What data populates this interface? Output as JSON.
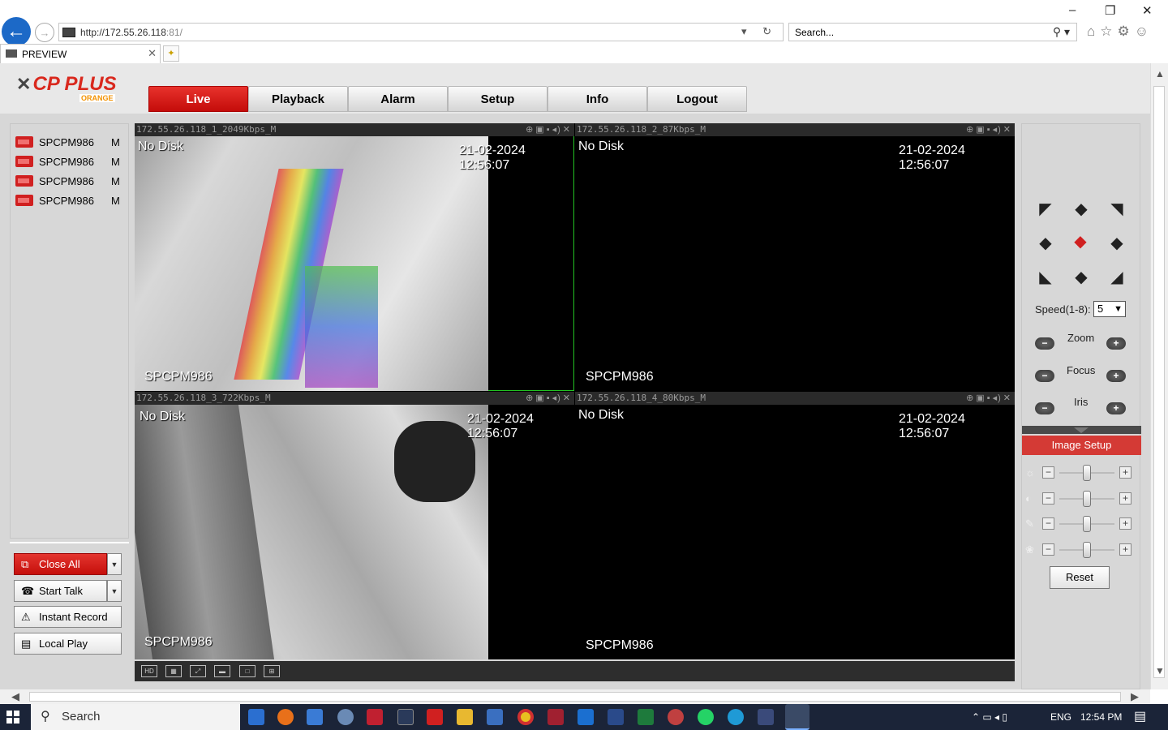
{
  "browser": {
    "url_prefix": "http://",
    "url_host": "172.55.26.118",
    "url_suffix": ":81/",
    "search_placeholder": "Search...",
    "tab_title": "PREVIEW",
    "minimize": "–",
    "restore": "❐",
    "close": "✕"
  },
  "app": {
    "logo_text": "CP PLUS",
    "logo_sub": "ORANGE",
    "nav": [
      {
        "label": "Live",
        "active": true
      },
      {
        "label": "Playback",
        "active": false
      },
      {
        "label": "Alarm",
        "active": false
      },
      {
        "label": "Setup",
        "active": false
      },
      {
        "label": "Info",
        "active": false
      },
      {
        "label": "Logout",
        "active": false
      }
    ],
    "channels": [
      {
        "name": "SPCPM986",
        "stream": "M"
      },
      {
        "name": "SPCPM986",
        "stream": "M"
      },
      {
        "name": "SPCPM986",
        "stream": "M"
      },
      {
        "name": "SPCPM986",
        "stream": "M"
      }
    ],
    "controls": {
      "close_all": "Close All",
      "start_talk": "Start Talk",
      "instant_record": "Instant Record",
      "local_play": "Local Play"
    },
    "video_cells": [
      {
        "title": "172.55.26.118_1_2049Kbps_M",
        "status": "No Disk",
        "timestamp": "21-02-2024 12:56:07",
        "camera": "SPCPM986"
      },
      {
        "title": "172.55.26.118_2_87Kbps_M",
        "status": "No Disk",
        "timestamp": "21-02-2024 12:56:07",
        "camera": "SPCPM986"
      },
      {
        "title": "172.55.26.118_3_722Kbps_M",
        "status": "No Disk",
        "timestamp": "21-02-2024 12:56:07",
        "camera": "SPCPM986"
      },
      {
        "title": "172.55.26.118_4_80Kbps_M",
        "status": "No Disk",
        "timestamp": "21-02-2024 12:56:07",
        "camera": "SPCPM986"
      }
    ],
    "ptz": {
      "speed_label": "Speed(1-8):",
      "speed_value": "5",
      "zoom_label": "Zoom",
      "focus_label": "Focus",
      "iris_label": "Iris",
      "image_setup": "Image Setup",
      "reset": "Reset"
    },
    "image_sliders": [
      {
        "icon": "brightness-icon",
        "value": 0.5
      },
      {
        "icon": "contrast-icon",
        "value": 0.5
      },
      {
        "icon": "saturation-icon",
        "value": 0.5
      },
      {
        "icon": "hue-icon",
        "value": 0.5
      }
    ]
  },
  "taskbar": {
    "search_label": "Search",
    "language": "ENG",
    "time": "12:54 PM"
  },
  "colors": {
    "accent_red": "#d43a35",
    "page_bg": "#d7d7d7",
    "selected_border": "#22c322"
  }
}
